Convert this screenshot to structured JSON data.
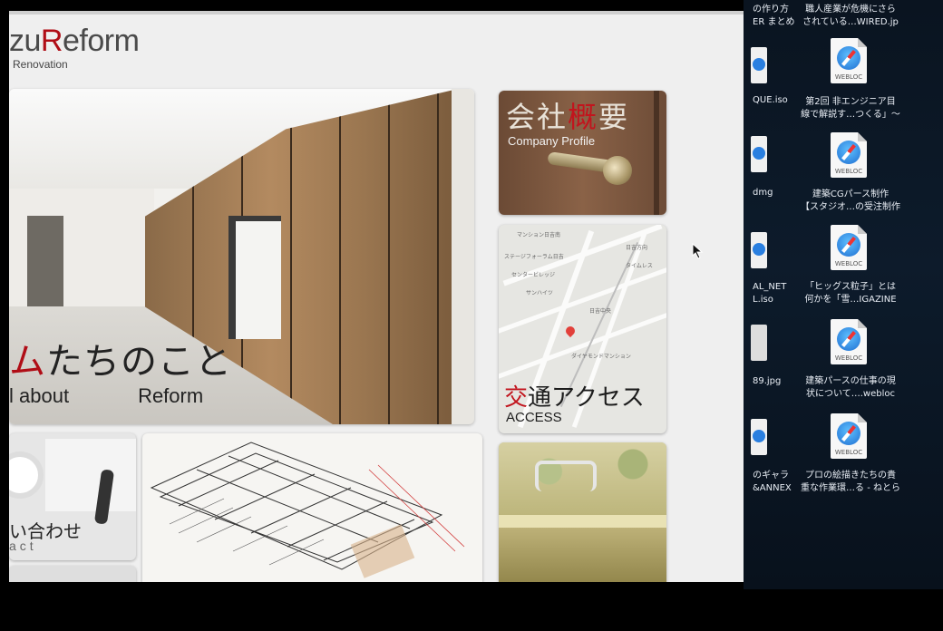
{
  "logo": {
    "brand_tail": "zu",
    "brand_r": "R",
    "brand_rest": "eform",
    "sub": "Renovation"
  },
  "hero": {
    "title_red": "ム",
    "title_rest": "たちのこと",
    "sub_left": "l about",
    "sub_right": "Reform"
  },
  "cards": {
    "company": {
      "jp_a": "会社",
      "jp_red": "概",
      "jp_b": "要",
      "en": "Company Profile"
    },
    "access": {
      "jp_red": "交",
      "jp_rest": "通アクセス",
      "en": "ACCESS"
    },
    "contact": {
      "jp": "い合わせ",
      "en": "act"
    }
  },
  "map_labels": [
    "マンション日吉南",
    "ステージフォーラム日吉",
    "センタービレッジ",
    "タイムレス",
    "サンハイツ",
    "日吉中央",
    "日吉方向",
    "ダイヤモンドマンション"
  ],
  "desktop": {
    "items": [
      {
        "label_l1": "職人産業が危機にさら",
        "label_l2": "されている…WIRED.jp"
      },
      {
        "label_l1": "第2回 非エンジニア目",
        "label_l2": "線で解説す…つくる」〜"
      },
      {
        "label_l1": "建築CGパース制作",
        "label_l2": "【スタジオ…の受注制作"
      },
      {
        "label_l1": "「ヒッグス粒子」とは",
        "label_l2": "何かを「雪…IGAZINE"
      },
      {
        "label_l1": "建築パースの仕事の現",
        "label_l2": "状について….webloc"
      },
      {
        "label_l1": "プロの絵描きたちの貴",
        "label_l2": "重な作業環…る - ねとら"
      }
    ],
    "webloc_tag": "WEBLOC",
    "partial": [
      {
        "l1": "の作り方",
        "l2": "ER まとめ"
      },
      {
        "l1": "QUE.iso",
        "l2": ""
      },
      {
        "l1": "dmg",
        "l2": ""
      },
      {
        "l1": "AL_NET",
        "l2": "L.iso"
      },
      {
        "l1": "89.jpg",
        "l2": ""
      },
      {
        "l1": "のギャラ",
        "l2": "&ANNEX"
      }
    ]
  },
  "colors": {
    "accent_red": "#b00d16",
    "desktop_bg": "#0d1b2b"
  }
}
